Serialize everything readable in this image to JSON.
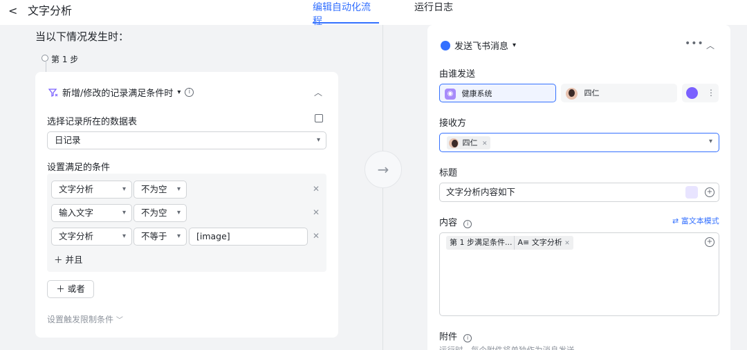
{
  "header": {
    "back_icon": "chevron-left",
    "title": "文字分析",
    "tabs": [
      "编辑自动化流程",
      "运行日志"
    ]
  },
  "trigger": {
    "when_title": "当以下情况发生时：",
    "step_label": "第 1 步",
    "card_title": "新增/修改的记录满足条件时",
    "table_label": "选择记录所在的数据表",
    "table_value": "日记录",
    "cond_label": "设置满足的条件",
    "conditions": [
      {
        "field": "文字分析",
        "op": "不为空",
        "value": ""
      },
      {
        "field": "输入文字",
        "op": "不为空",
        "value": ""
      },
      {
        "field": "文字分析",
        "op": "不等于",
        "value": "[image]"
      }
    ],
    "and_button": "并且",
    "or_button": "或者",
    "limit_link": "设置触发限制条件"
  },
  "action": {
    "title": "发送飞书消息",
    "sender_label": "由谁发送",
    "sender_app": "健康系统",
    "sender_user": "四仁",
    "receiver_label": "接收方",
    "receiver_chip": "四仁",
    "title_label": "标题",
    "title_value": "文字分析内容如下",
    "content_label": "内容",
    "rich_text_link": "富文本模式",
    "content_pill_step": "第 1 步满足条件...",
    "content_pill_field": "文字分析",
    "attach_label": "附件",
    "attach_hint": "运行时，每个附件将单独作为消息发送"
  },
  "colors": {
    "accent": "#3370ff",
    "purple": "#7b61ff"
  }
}
